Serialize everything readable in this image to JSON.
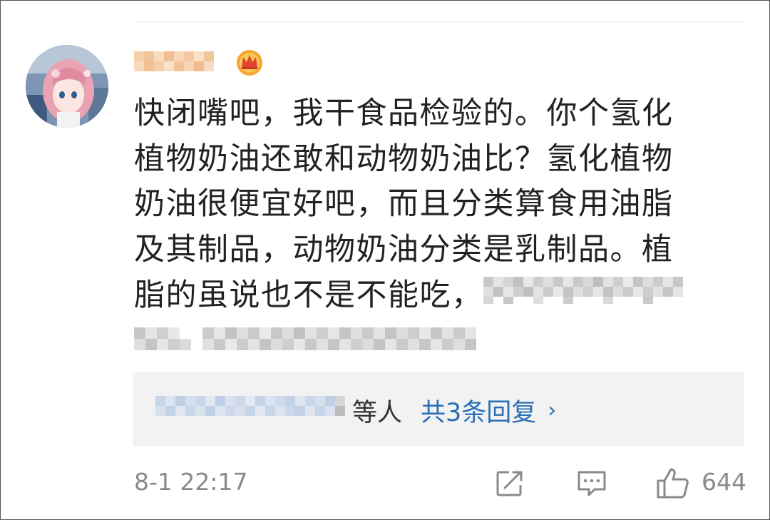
{
  "comment": {
    "author_badge": "crown-badge",
    "lines": [
      "快闭嘴吧，我干食品检验的。你个氢化",
      "植物奶油还敢和动物奶油比？氢化植物",
      "奶油很便宜好吧，而且分类算食用油脂",
      "及其制品，动物奶油分类是乳制品。植",
      "脂的虽说也不是不能吃，"
    ],
    "text_color": "#222222"
  },
  "replies": {
    "suffix": "等人",
    "link_label": "共3条回复",
    "chevron": "›",
    "link_color": "#2a6fb6",
    "box_color": "#f2f2f2"
  },
  "footer": {
    "time": "8-1 22:17",
    "like_count": "644",
    "icons": [
      "share-icon",
      "comment-icon",
      "like-icon"
    ]
  }
}
